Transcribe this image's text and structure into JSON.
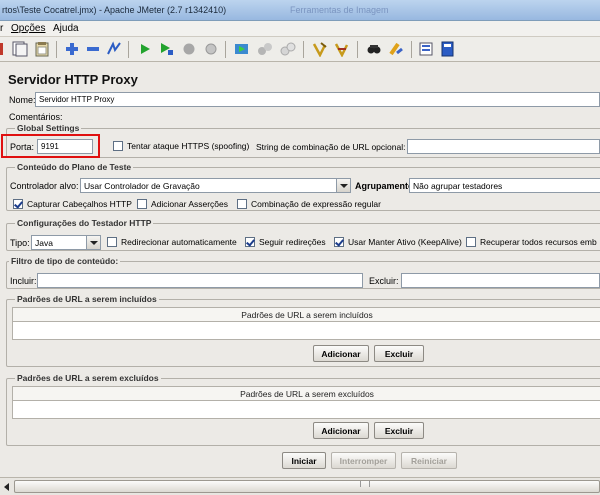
{
  "window": {
    "title": "rtos\\Teste Cocatrel.jmx) - Apache JMeter (2.7 r1342410)",
    "ghost_text": "Ferramentas de Imagem"
  },
  "menu": {
    "items": [
      "r",
      "Opções",
      "Ajuda"
    ]
  },
  "toolbar": {
    "icons": [
      "new-icon",
      "templates-icon",
      "open-icon",
      "expand-icon",
      "collapse-icon",
      "toggle-icon",
      "start-icon",
      "start-no-pauses-icon",
      "stop-icon",
      "shutdown-icon",
      "remote-start-icon",
      "remote-stop-icon",
      "remote-shutdown-icon",
      "clear-icon",
      "clear-all-icon",
      "search-icon",
      "reset-search-icon",
      "function-helper-icon",
      "help-icon"
    ]
  },
  "panel": {
    "heading": "Servidor HTTP Proxy",
    "name_label": "Nome:",
    "name_value": "Servidor HTTP Proxy",
    "comments_label": "Comentários:",
    "global": {
      "legend": "Global Settings",
      "port_label": "Porta:",
      "port_value": "9191",
      "https_label": "Tentar ataque HTTPS (spoofing)",
      "url_match_label": "String de combinação de URL opcional:"
    },
    "plan": {
      "legend": "Conteúdo do Plano de Teste",
      "controller_label": "Controlador alvo:",
      "controller_value": "Usar Controlador de Gravação",
      "grouping_label": "Agrupamento:",
      "grouping_value": "Não agrupar testadores",
      "capture_headers": "Capturar Cabeçalhos HTTP",
      "add_assertions": "Adicionar Asserções",
      "regex_match": "Combinação de expressão regular"
    },
    "sampler": {
      "legend": "Configurações do Testador HTTP",
      "type_label": "Tipo:",
      "type_value": "Java",
      "redirect_auto": "Redirecionar automaticamente",
      "follow_redirects": "Seguir redireções",
      "keepalive": "Usar Manter Ativo (KeepAlive)",
      "retrieve_all": "Recuperar todos recursos emb"
    },
    "content_filter": {
      "legend": "Filtro de tipo de conteúdo:",
      "include_label": "Incluir:",
      "exclude_label": "Excluir:"
    },
    "included": {
      "legend": "Padrões de URL a serem incluídos",
      "header": "Padrões de URL a serem incluídos",
      "add_button": "Adicionar",
      "delete_button": "Excluir"
    },
    "excluded": {
      "legend": "Padrões de URL a serem excluídos",
      "header": "Padrões de URL a serem excluídos",
      "add_button": "Adicionar",
      "delete_button": "Excluir"
    },
    "controls": {
      "start": "Iniciar",
      "stop": "Interromper",
      "restart": "Reiniciar"
    }
  },
  "colors": {
    "highlight": "#e01010",
    "title_gradient": "#bcd4ee"
  }
}
